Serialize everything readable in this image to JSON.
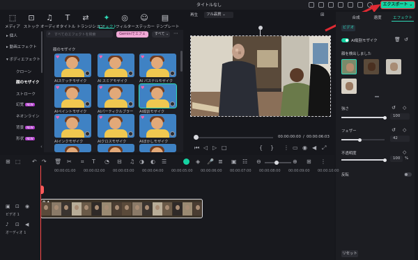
{
  "window": {
    "title": "タイトルなし",
    "export_label": "エクスポート"
  },
  "toolbar": [
    {
      "label": "メディア",
      "icon": "media-icon"
    },
    {
      "label": "ストック",
      "icon": "stock-icon"
    },
    {
      "label": "オーディオ",
      "icon": "audio-icon"
    },
    {
      "label": "タイトル",
      "icon": "title-icon"
    },
    {
      "label": "トランジション",
      "icon": "transition-icon"
    },
    {
      "label": "エフェクト",
      "icon": "effect-icon",
      "active": true
    },
    {
      "label": "フィルター",
      "icon": "filter-icon"
    },
    {
      "label": "ステッカー",
      "icon": "sticker-icon"
    },
    {
      "label": "テンプレート",
      "icon": "template-icon"
    }
  ],
  "sidebar": [
    {
      "label": "個人"
    },
    {
      "label": "動画エフェクト"
    },
    {
      "label": "ボディエフェクト"
    },
    {
      "label": "クローン"
    },
    {
      "label": "顔のモザイク"
    },
    {
      "label": "ストローク"
    },
    {
      "label": "幻覚",
      "badge": "NEW"
    },
    {
      "label": "ネオンライン"
    },
    {
      "label": "背景",
      "badge": "NEW"
    },
    {
      "label": "形状",
      "badge": "NEW"
    }
  ],
  "effects": {
    "search_placeholder": "すべてのエフェクトを検索",
    "gemini_label": "Geminiでエフェ",
    "filter_label": "すべて",
    "category": "顔のモザイク",
    "items": [
      {
        "label": "AIスケッチモザイク"
      },
      {
        "label": "AI スミアモザイク"
      },
      {
        "label": "AI パステルモザイク"
      },
      {
        "label": "AIペイントモザイク"
      },
      {
        "label": "AIパーティクルブラー"
      },
      {
        "label": "AI縦割モザイク"
      },
      {
        "label": "AIインクモザイク"
      },
      {
        "label": "AIクロスモザイク"
      },
      {
        "label": "AIぼかしモザイク"
      }
    ]
  },
  "preview": {
    "label": "再生",
    "quality": "フル品質",
    "current_time": "00:00:00:00",
    "separator": "/",
    "total_time": "00:00:06:03"
  },
  "right_panel": {
    "tabs": [
      "合成",
      "速度",
      "エフェクト"
    ],
    "sub_tab": "ビデオ",
    "effect_name": "AI縦割モザイク",
    "faces_label": "顔を検出しました",
    "strength": {
      "label": "強さ",
      "value": "100",
      "fraction": 1.0
    },
    "feather": {
      "label": "フェザー",
      "value": "42",
      "fraction": 0.42
    },
    "opacity": {
      "label": "不透明度",
      "value": "100",
      "unit": "%",
      "fraction": 1.0
    },
    "invert": {
      "label": "反転"
    },
    "reset_label": "リセット"
  },
  "timeline": {
    "ticks": [
      "00:00:01:00",
      "00:00:02:00",
      "00:00:03:00",
      "00:00:04:00",
      "00:00:05:00",
      "00:00:06:00",
      "00:00:07:00",
      "00:00:08:00",
      "00:00:09:00",
      "00:00:10:00"
    ],
    "video_track": "ビデオ 1",
    "audio_track": "オーディオ 1"
  }
}
